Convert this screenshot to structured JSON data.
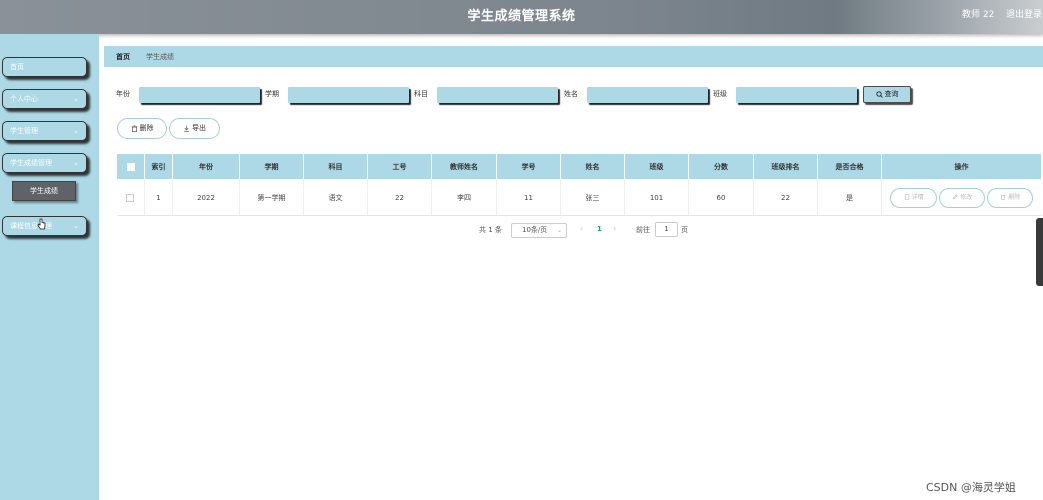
{
  "header": {
    "title": "学生成绩管理系统",
    "user": "教师 22",
    "logout": "退出登录"
  },
  "sidebar": {
    "items": [
      {
        "label": "首页",
        "has_arrow": false
      },
      {
        "label": "个人中心",
        "has_arrow": true
      },
      {
        "label": "学生管理",
        "has_arrow": true
      },
      {
        "label": "学生成绩管理",
        "has_arrow": true
      },
      {
        "label": "课程信息管理",
        "has_arrow": true
      }
    ],
    "submenu": {
      "label": "学生成绩"
    }
  },
  "breadcrumb": {
    "home": "首页",
    "current": "学生成绩"
  },
  "search": {
    "fields": [
      {
        "label": "年份",
        "value": ""
      },
      {
        "label": "学期",
        "value": ""
      },
      {
        "label": "科目",
        "value": ""
      },
      {
        "label": "姓名",
        "value": ""
      },
      {
        "label": "班级",
        "value": ""
      }
    ],
    "query_button": "查询"
  },
  "actions": {
    "delete": "删除",
    "export": "导出"
  },
  "table": {
    "headers": [
      "索引",
      "年份",
      "学期",
      "科目",
      "工号",
      "教师姓名",
      "学号",
      "姓名",
      "班级",
      "分数",
      "班级排名",
      "是否合格",
      "操作"
    ],
    "rows": [
      {
        "cells": [
          "1",
          "2022",
          "第一学期",
          "语文",
          "22",
          "李四",
          "11",
          "张三",
          "101",
          "60",
          "22",
          "是"
        ]
      }
    ],
    "op_buttons": {
      "detail": "详情",
      "edit": "修改",
      "delete": "删除"
    }
  },
  "pagination": {
    "total": "共 1 条",
    "page_size": "10条/页",
    "current_page": "1",
    "goto_label": "前往",
    "goto_value": "1",
    "page_unit": "页"
  },
  "watermark": "CSDN @海灵学姐",
  "colors": {
    "accent": "#add8e6",
    "header": "#7c858d",
    "submenu": "#5f6266",
    "active_page": "#2a9d6a"
  }
}
